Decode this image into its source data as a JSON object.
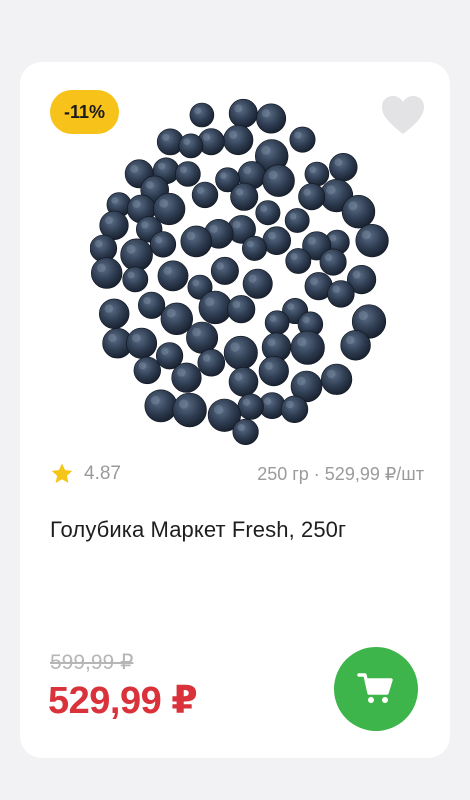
{
  "badge": {
    "text": "-11%"
  },
  "product": {
    "rating": "4.87",
    "pack_info": "250 гр · 529,99 ₽/шт",
    "name": "Голубика Маркет Fresh, 250г",
    "old_price": "599,99 ₽",
    "price": "529,99 ₽"
  },
  "icons": {
    "favorite": "heart-icon",
    "rating": "star-icon",
    "cart": "cart-icon"
  },
  "colors": {
    "badge": "#f7c21a",
    "price": "#d9323b",
    "cart_button": "#3db54a",
    "star": "#f5c518",
    "heart": "#e3e3e6"
  }
}
